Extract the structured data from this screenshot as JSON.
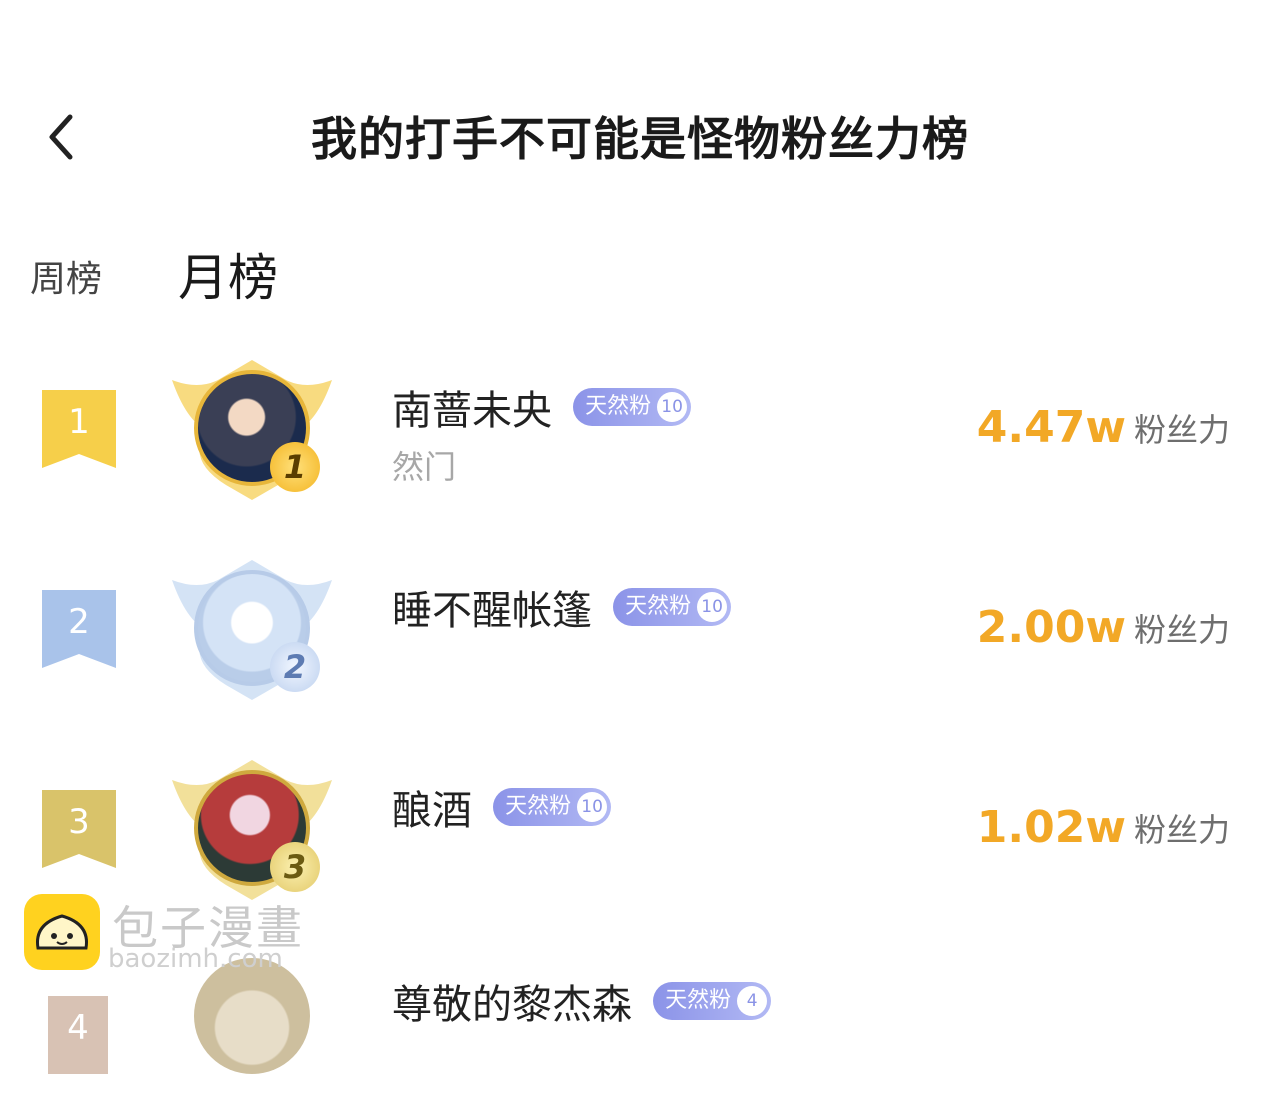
{
  "header": {
    "title": "我的打手不可能是怪物粉丝力榜"
  },
  "tabs": [
    {
      "label": "周榜",
      "active": false
    },
    {
      "label": "月榜",
      "active": true
    }
  ],
  "ranking": [
    {
      "rank": "1",
      "name": "南蔷未央",
      "badge": "天然粉",
      "badge_level": "10",
      "subtitle": "然门",
      "score": "4.47w",
      "unit": "粉丝力",
      "ribbon_color": "#f6cf4a",
      "medal": "1"
    },
    {
      "rank": "2",
      "name": "睡不醒帐篷",
      "badge": "天然粉",
      "badge_level": "10",
      "subtitle": "",
      "score": "2.00w",
      "unit": "粉丝力",
      "ribbon_color": "#a9c3ea",
      "medal": "2"
    },
    {
      "rank": "3",
      "name": "酿酒",
      "badge": "天然粉",
      "badge_level": "10",
      "subtitle": "",
      "score": "1.02w",
      "unit": "粉丝力",
      "ribbon_color": "#d9c36a",
      "medal": "3"
    },
    {
      "rank": "4",
      "name": "尊敬的黎杰森",
      "badge": "天然粉",
      "badge_level": "4",
      "subtitle": "",
      "score": "",
      "unit": "",
      "ribbon_color": "#d8c2b4",
      "medal": ""
    }
  ],
  "watermark": {
    "cn": "包子漫畫",
    "en": "baozimh.com"
  },
  "colors": {
    "score": "#f2a826",
    "badge_start": "#8b93e8",
    "badge_end": "#b2b9f4"
  },
  "icons": {
    "back": "chevron-left-icon"
  }
}
